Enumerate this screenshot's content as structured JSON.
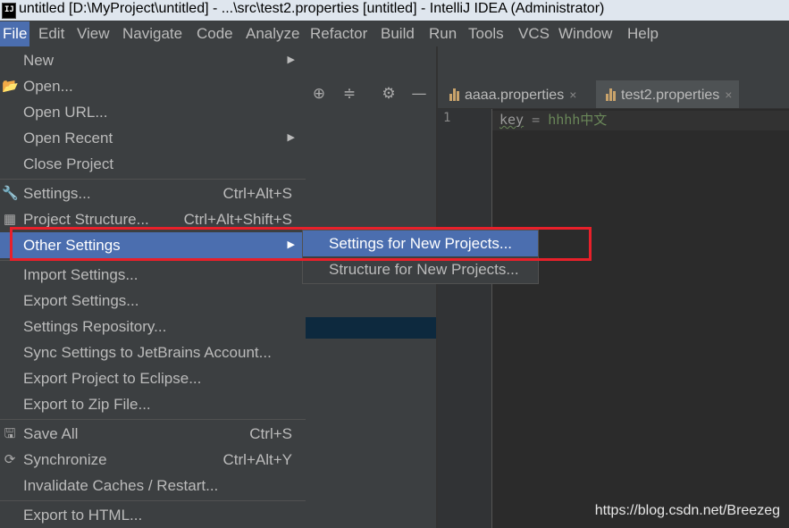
{
  "window": {
    "title": "untitled [D:\\MyProject\\untitled] - ...\\src\\test2.properties [untitled] - IntelliJ IDEA (Administrator)",
    "app_icon_text": "IJ"
  },
  "menubar": [
    "File",
    "Edit",
    "View",
    "Navigate",
    "Code",
    "Analyze",
    "Refactor",
    "Build",
    "Run",
    "Tools",
    "VCS",
    "Window",
    "Help"
  ],
  "file_menu": {
    "new": "New",
    "open": "Open...",
    "open_url": "Open URL...",
    "open_recent": "Open Recent",
    "close_project": "Close Project",
    "settings": "Settings...",
    "settings_shortcut": "Ctrl+Alt+S",
    "project_structure": "Project Structure...",
    "project_structure_shortcut": "Ctrl+Alt+Shift+S",
    "other_settings": "Other Settings",
    "import_settings": "Import Settings...",
    "export_settings": "Export Settings...",
    "settings_repository": "Settings Repository...",
    "sync_settings": "Sync Settings to JetBrains Account...",
    "export_eclipse": "Export Project to Eclipse...",
    "export_zip": "Export to Zip File...",
    "save_all": "Save All",
    "save_all_shortcut": "Ctrl+S",
    "synchronize": "Synchronize",
    "synchronize_shortcut": "Ctrl+Alt+Y",
    "invalidate_caches": "Invalidate Caches / Restart...",
    "export_html": "Export to HTML..."
  },
  "submenu": {
    "settings_new_projects": "Settings for New Projects...",
    "structure_new_projects": "Structure for New Projects..."
  },
  "tabs": [
    {
      "label": "aaaa.properties",
      "close": "×"
    },
    {
      "label": "test2.properties",
      "close": "×"
    }
  ],
  "editor": {
    "line_number": "1",
    "key": "key",
    "equals": " = ",
    "value": "hhhh中文"
  },
  "watermark": "https://blog.csdn.net/Breezeg",
  "colors": {
    "highlight": "#4b6eaf",
    "menu_bg": "#3c3f41",
    "editor_bg": "#2b2b2b",
    "annotation_red": "#e8202a"
  }
}
